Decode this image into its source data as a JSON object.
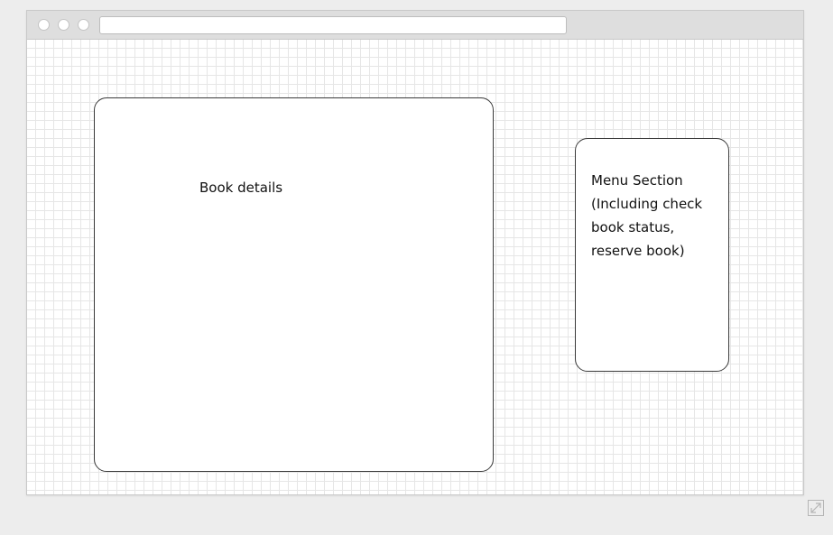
{
  "window": {
    "address_bar": ""
  },
  "book_panel": {
    "label": "Book details"
  },
  "menu_panel": {
    "lines": [
      "Menu Section",
      "(Including check",
      "book status,",
      "reserve book)"
    ]
  },
  "icons": {
    "expand": "expand-icon"
  },
  "colors": {
    "page_background": "#ededed",
    "titlebar": "#dedede",
    "grid_line": "#e6e6e6",
    "panel_border": "#3a3a3a"
  }
}
